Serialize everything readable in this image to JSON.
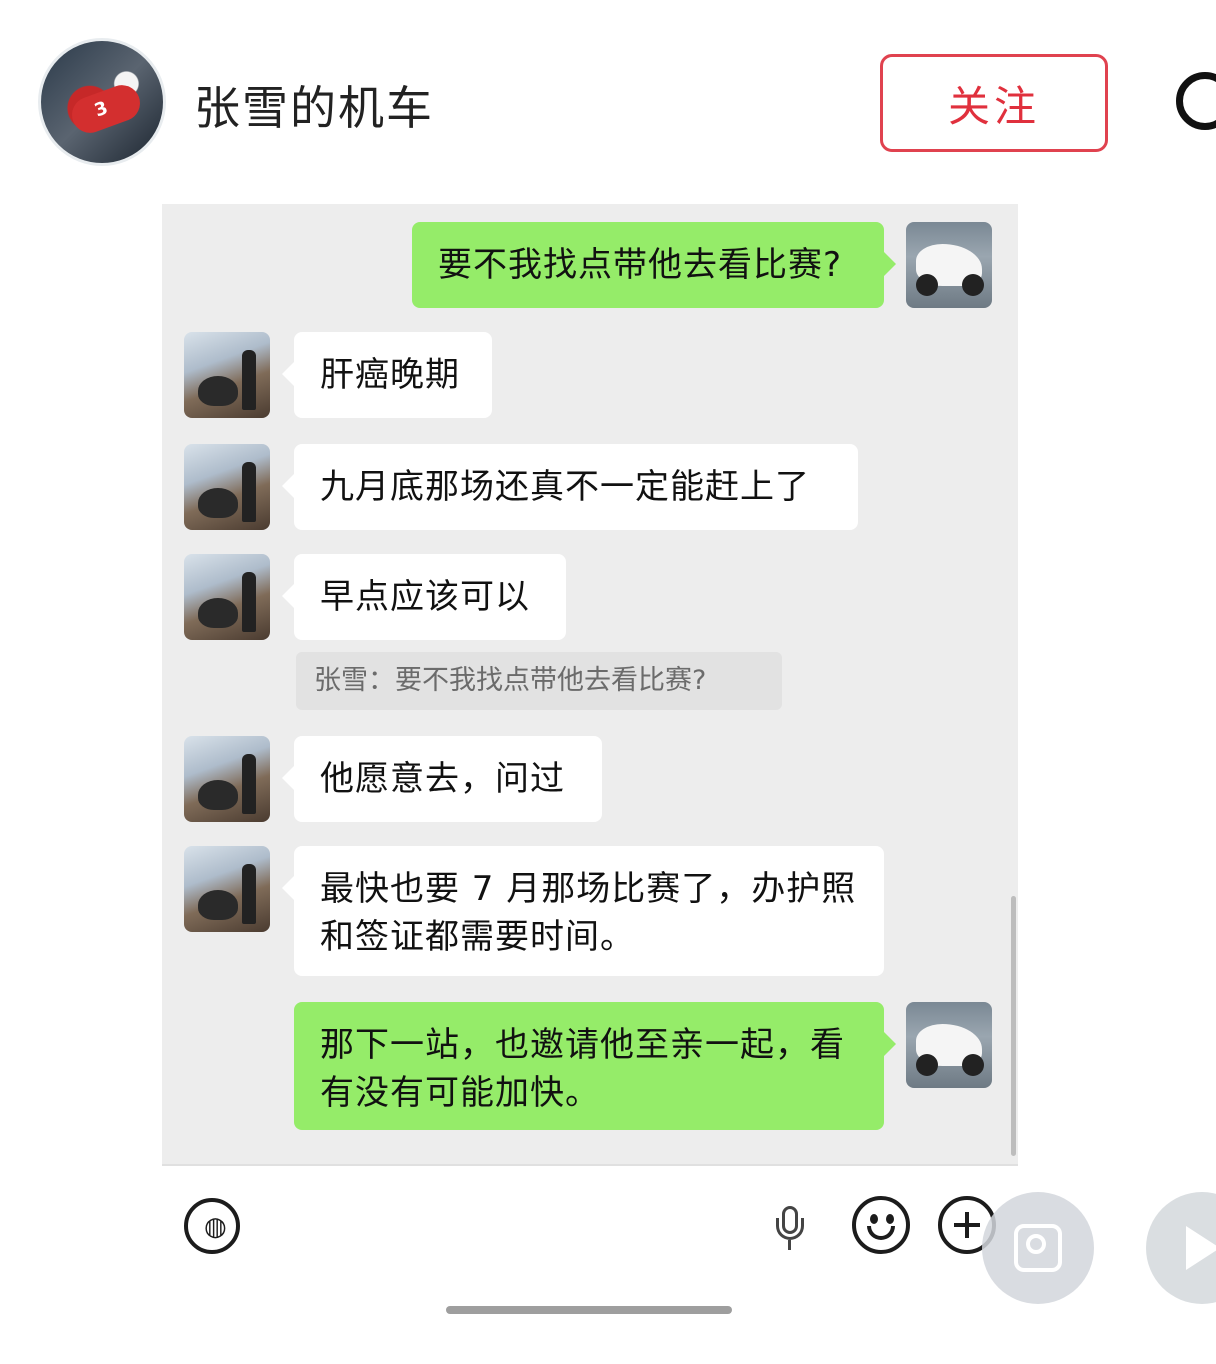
{
  "header": {
    "account_name": "张雪的机车",
    "follow_label": "关注",
    "avatar_number": "3"
  },
  "chat": {
    "messages": [
      {
        "sender": "self",
        "text": "要不我找点带他去看比赛?"
      },
      {
        "sender": "other",
        "text": "肝癌晚期"
      },
      {
        "sender": "other",
        "text": "九月底那场还真不一定能赶上了"
      },
      {
        "sender": "other",
        "text": "早点应该可以"
      },
      {
        "sender": "other",
        "text": "他愿意去，问过"
      },
      {
        "sender": "other",
        "text": "最快也要 7 月那场比赛了，办护照和签证都需要时间。"
      },
      {
        "sender": "self",
        "text": "那下一站，也邀请他至亲一起，看有没有可能加快。"
      }
    ],
    "quoted_reply": "张雪：要不我找点带他去看比赛?"
  },
  "input_bar": {
    "voice_glyph": "◍",
    "icons": [
      "voice-icon",
      "microphone-icon",
      "emoji-icon",
      "plus-icon"
    ]
  },
  "floating_buttons": [
    "lens-search-icon",
    "play-icon"
  ],
  "colors": {
    "follow_border": "#e0424f",
    "self_bubble": "#95ec69",
    "other_bubble": "#ffffff",
    "chat_background": "#ededed"
  }
}
